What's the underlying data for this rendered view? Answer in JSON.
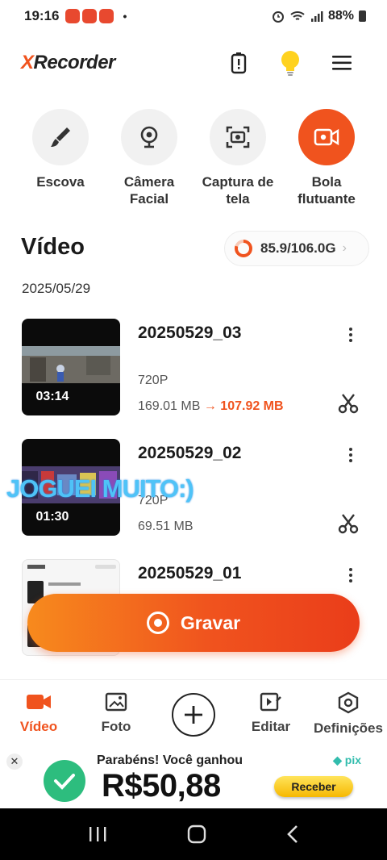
{
  "status_bar": {
    "time": "19:16",
    "dot": "•",
    "battery": "88%"
  },
  "header": {
    "logo_x": "X",
    "logo_rest": "Recorder"
  },
  "tools": [
    {
      "label": "Escova",
      "icon": "brush-icon"
    },
    {
      "label": "Câmera\nFacial",
      "icon": "webcam-icon"
    },
    {
      "label": "Captura de\ntela",
      "icon": "screenshot-icon"
    },
    {
      "label": "Bola\nflutuante",
      "icon": "floating-ball-icon"
    }
  ],
  "section": {
    "title": "Vídeo",
    "storage": "85.9/106.0G",
    "storage_used_fraction": 0.81,
    "date": "2025/05/29"
  },
  "videos": [
    {
      "title": "20250529_03",
      "duration": "03:14",
      "resolution": "720P",
      "size": "169.01 MB",
      "arrow": "→",
      "compressed": "107.92 MB"
    },
    {
      "title": "20250529_02",
      "duration": "01:30",
      "resolution": "720P",
      "size": "69.51 MB"
    },
    {
      "title": "20250529_01"
    }
  ],
  "overlay_text": "JOGUEI MUITO:)",
  "record_button": {
    "label": "Gravar"
  },
  "bottom_nav": [
    {
      "label": "Vídeo",
      "active": true
    },
    {
      "label": "Foto"
    },
    {
      "label": "Editar"
    },
    {
      "label": "Definições"
    }
  ],
  "ad": {
    "close": "✕",
    "line1": "Parabéns! Você ganhou",
    "amount": "R$50,88",
    "brand": "pix",
    "button": "Receber"
  },
  "colors": {
    "accent": "#f0531e",
    "ad_green": "#2dbd7e",
    "overlay_blue": "#4fc3f7"
  }
}
